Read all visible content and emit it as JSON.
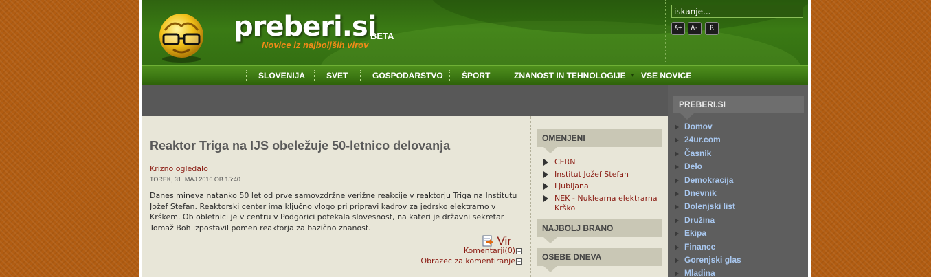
{
  "header": {
    "brand": "preberi.si",
    "beta": "BETA",
    "tagline": "Novice iz najboljših virov",
    "search_placeholder": "iskanje...",
    "font_buttons": [
      "A+",
      "A-",
      "R"
    ]
  },
  "nav": {
    "items": [
      "SLOVENIJA",
      "SVET",
      "GOSPODARSTVO",
      "ŠPORT",
      "ZNANOST IN TEHNOLOGIJE",
      "VSE NOVICE"
    ]
  },
  "article": {
    "title": "Reaktor Triga na IJS obeležuje 50-letnico delovanja",
    "source": "Krizno ogledalo",
    "date": "TOREK, 31. MAJ 2016 OB 15:40",
    "text": "Danes mineva natanko 50 let od prve samovzdržne verižne reakcije v reaktorju Triga na Institutu Jožef Stefan. Reaktorski center ima ključno vlogo pri pripravi kadrov za jedrsko elektrarno v Krškem. Ob obletnici je v centru v Podgorici potekala slovesnost, na kateri je državni sekretar Tomaž Boh izpostavil pomen reaktorja za bazično znanost.",
    "vir_label": "Vir",
    "comments_label": "Komentarji(0)",
    "comment_form_label": "Obrazec za komentiranje"
  },
  "omenjeni": {
    "heading": "OMENJENI",
    "items": [
      "CERN",
      "Institut Jožef Stefan",
      "Ljubljana",
      "NEK - Nuklearna elektrarna Krško"
    ]
  },
  "najbolj_brano": {
    "heading": "NAJBOLJ BRANO"
  },
  "osebe_dneva": {
    "heading": "OSEBE DNEVA"
  },
  "sidebar": {
    "heading": "PREBERI.SI",
    "items": [
      "Domov",
      "24ur.com",
      "Časnik",
      "Delo",
      "Demokracija",
      "Dnevnik",
      "Dolenjski list",
      "Družina",
      "Ekipa",
      "Finance",
      "Gorenjski glas",
      "Mladina"
    ]
  },
  "colors": {
    "header_green": "#3a7a14",
    "tagline_orange": "#f08a18",
    "link_red": "#8a1b12",
    "sidebar_link_blue": "#a9c8f0",
    "background_orange": "#b25d12"
  }
}
